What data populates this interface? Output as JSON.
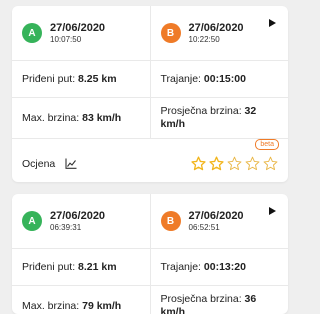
{
  "colors": {
    "start_badge": "#36b35a",
    "end_badge": "#ef7b28",
    "star_filled": "#f2b51c",
    "star_empty": "#e9b645",
    "beta": "#ef7b28"
  },
  "trips": [
    {
      "start": {
        "badge": "A",
        "date": "27/06/2020",
        "time": "10:07:50"
      },
      "end": {
        "badge": "B",
        "date": "27/06/2020",
        "time": "10:22:50"
      },
      "distance_label": "Priđeni put:",
      "distance_value": "8.25 km",
      "duration_label": "Trajanje:",
      "duration_value": "00:15:00",
      "max_speed_label": "Max. brzina:",
      "max_speed_value": "83 km/h",
      "avg_speed_label": "Prosječna brzina:",
      "avg_speed_value": "32 km/h",
      "rating_label": "Ocjena",
      "rating_badge": "beta",
      "rating_stars": 2,
      "rating_max": 5
    },
    {
      "start": {
        "badge": "A",
        "date": "27/06/2020",
        "time": "06:39:31"
      },
      "end": {
        "badge": "B",
        "date": "27/06/2020",
        "time": "06:52:51"
      },
      "distance_label": "Priđeni put:",
      "distance_value": "8.21 km",
      "duration_label": "Trajanje:",
      "duration_value": "00:13:20",
      "max_speed_label": "Max. brzina:",
      "max_speed_value": "79 km/h",
      "avg_speed_label": "Prosječna brzina:",
      "avg_speed_value": "36 km/h"
    }
  ]
}
